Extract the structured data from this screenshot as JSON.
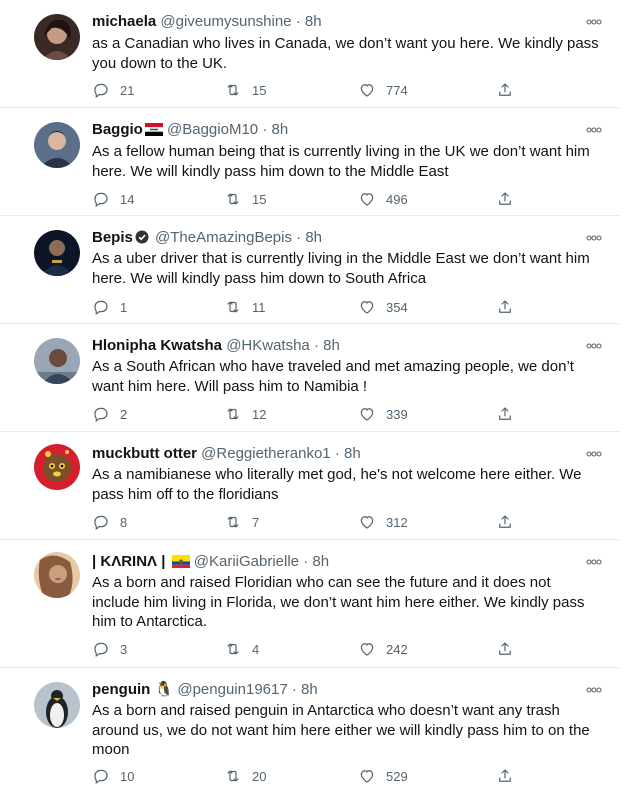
{
  "tweets": [
    {
      "name": "michaela",
      "handle": "@giveumysunshine",
      "dot": "·",
      "time": "8h",
      "text": "as a Canadian who lives in Canada, we don’t want you here. We kindly pass you down to the UK.",
      "replies": "21",
      "retweets": "15",
      "likes": "774",
      "avatar_colors": [
        "#3a2a26",
        "#c79a86",
        "#6b4b44"
      ]
    },
    {
      "name": "Baggio",
      "handle": "@BaggioM10",
      "dot": "·",
      "time": "8h",
      "text": "As a fellow human being that is currently living in the UK we don’t want him here. We will kindly pass him down to the Middle East",
      "replies": "14",
      "retweets": "15",
      "likes": "496",
      "flag": "iraq-flag",
      "avatar_colors": [
        "#5b6e8a",
        "#d8b79e",
        "#2b3344"
      ]
    },
    {
      "name": "Bepis",
      "handle": "@TheAmazingBepis",
      "dot": "·",
      "time": "8h",
      "text": "As a uber driver that is currently living in the Middle East we don’t want him here. We will kindly pass him down to South Africa",
      "replies": "1",
      "retweets": "11",
      "likes": "354",
      "verified": true,
      "avatar_colors": [
        "#0c1426",
        "#8d6b54",
        "#1c2a4a"
      ]
    },
    {
      "name": "Hlonipha Kwatsha",
      "handle": "@HKwatsha",
      "dot": "·",
      "time": "8h",
      "text": "As a South African who have traveled and met amazing people, we don’t want him here. Will pass him to Namibia !",
      "replies": "2",
      "retweets": "12",
      "likes": "339",
      "avatar_colors": [
        "#9aa6b6",
        "#6a4a3a",
        "#2e3d52"
      ]
    },
    {
      "name": "muckbutt otter",
      "handle": "@Reggietheranko1",
      "dot": "·",
      "time": "8h",
      "text": "As a namibianese who literally met god, he's not welcome here either. We pass him off to the floridians",
      "replies": "8",
      "retweets": "7",
      "likes": "312",
      "avatar_colors": [
        "#d61f2c",
        "#7a4f2a",
        "#f2d43a"
      ]
    },
    {
      "name": "| KΛRINΛ |",
      "handle": "@KariiGabrielle",
      "dot": "·",
      "time": "8h",
      "text": "As a born and raised Floridian who can see the future and it does not include him living in Florida, we don’t want him here either. We kindly pass him to Antarctica.",
      "replies": "3",
      "retweets": "4",
      "likes": "242",
      "flag": "ecuador-flag",
      "avatar_colors": [
        "#c9a07e",
        "#8a5b3e",
        "#e8c9a8"
      ]
    },
    {
      "name": "penguin",
      "handle": "@penguin19617",
      "dot": "·",
      "time": "8h",
      "text": "As a born and raised penguin in Antarctica who doesn’t want any trash around us, we do not want him here either we will kindly pass him to on the moon",
      "replies": "10",
      "retweets": "20",
      "likes": "529",
      "penguin_emoji": "🐧",
      "avatar_colors": [
        "#b7c3cc",
        "#1e2328",
        "#f1f1f1"
      ]
    }
  ],
  "icons": {
    "reply": "reply-icon",
    "retweet": "retweet-icon",
    "like": "heart-icon",
    "share": "share-icon",
    "more": "more-icon",
    "verified": "verified-icon"
  },
  "colors": {
    "text": "#0f1419",
    "secondary": "#536471",
    "divider": "#e6ecf0"
  }
}
